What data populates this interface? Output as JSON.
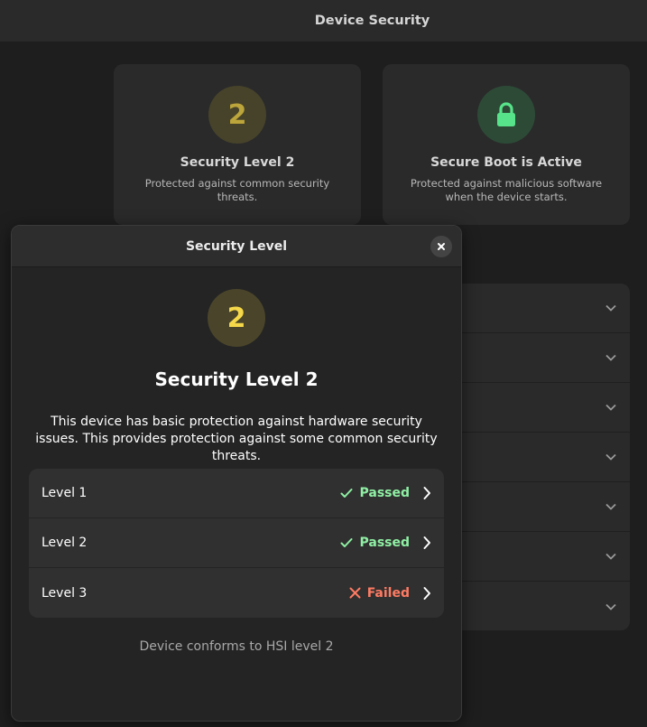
{
  "window": {
    "title": "Device Security"
  },
  "cards": {
    "level": {
      "badge": "2",
      "title": "Security Level 2",
      "description": "Protected against common security threats."
    },
    "boot": {
      "icon": "lock-icon",
      "title": "Secure Boot is Active",
      "description": "Protected against malicious software when the device starts."
    }
  },
  "dialog": {
    "title": "Security Level",
    "badge": "2",
    "heading": "Security Level 2",
    "description": "This device has basic protection against hardware security issues. This provides protection against some common security threats.",
    "levels": [
      {
        "name": "Level 1",
        "status": "Passed"
      },
      {
        "name": "Level 2",
        "status": "Passed"
      },
      {
        "name": "Level 3",
        "status": "Failed"
      }
    ],
    "footer": "Device conforms to HSI level 2"
  },
  "colors": {
    "passed": "#8ff0a4",
    "failed": "#ff7b63",
    "level_badge": "#f5d84a",
    "secure_badge": "#57e389"
  }
}
